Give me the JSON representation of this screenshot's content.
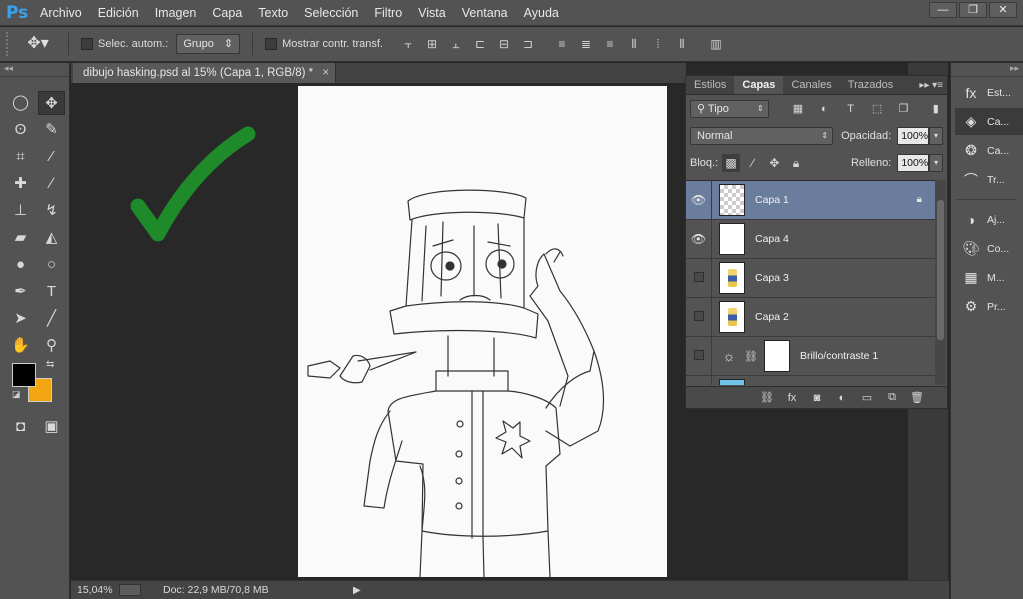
{
  "app": {
    "logo": "Ps",
    "menu": [
      "Archivo",
      "Edición",
      "Imagen",
      "Capa",
      "Texto",
      "Selección",
      "Filtro",
      "Vista",
      "Ventana",
      "Ayuda"
    ],
    "window_controls": [
      "—",
      "❐",
      "✕"
    ]
  },
  "options": {
    "move_icon": "move-icon",
    "auto_select_label": "Selec. autom.:",
    "auto_select_value": "Grupo",
    "transform_label": "Mostrar contr. transf."
  },
  "document": {
    "tab_label": "dibujo hasking.psd al 15% (Capa 1, RGB/8) *",
    "close": "×"
  },
  "status": {
    "zoom": "15,04%",
    "doc_info": "Doc: 22,9 MB/70,8 MB"
  },
  "colors": {
    "foreground": "#000000",
    "background": "#f2a612",
    "check_mark": "#1e8a2a",
    "selected_layer": "#6b7d9c"
  },
  "layers_panel": {
    "tabs": [
      "Estilos",
      "Capas",
      "Canales",
      "Trazados"
    ],
    "active_tab": "Capas",
    "filter_kind": "Tipo",
    "blend_mode": "Normal",
    "opacity_label": "Opacidad:",
    "opacity_value": "100%",
    "lock_label": "Bloq.:",
    "fill_label": "Relleno:",
    "fill_value": "100%",
    "layers": [
      {
        "name": "Capa 1",
        "visible": true,
        "selected": true,
        "locked": true
      },
      {
        "name": "Capa 4",
        "visible": true,
        "selected": false,
        "locked": false
      },
      {
        "name": "Capa 3",
        "visible": false,
        "selected": false,
        "locked": false
      },
      {
        "name": "Capa 2",
        "visible": false,
        "selected": false,
        "locked": false
      },
      {
        "name": "Brillo/contraste 1",
        "visible": false,
        "selected": false,
        "locked": false
      }
    ]
  },
  "right_dock": {
    "items": [
      "Est...",
      "Ca...",
      "Ca...",
      "Tr...",
      "Aj...",
      "Co...",
      "M...",
      "Pr..."
    ],
    "active_index": 1
  }
}
